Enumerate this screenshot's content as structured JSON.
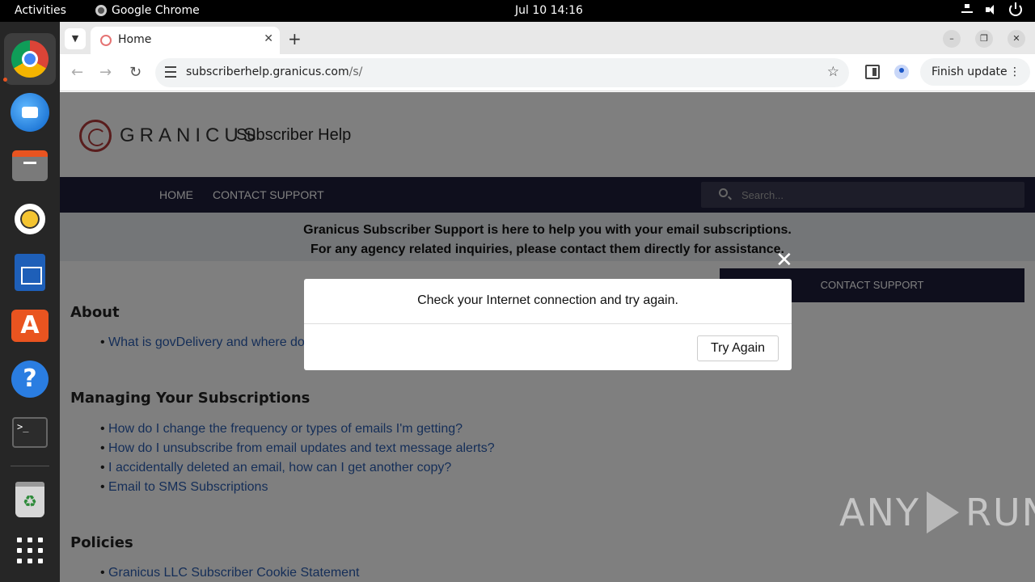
{
  "topbar": {
    "activities": "Activities",
    "app": "Google Chrome",
    "date": "Jul 10",
    "time": "14:16"
  },
  "dock": {
    "icons": [
      "chrome-icon",
      "thunderbird-icon",
      "files-icon",
      "rhythmbox-icon",
      "writer-icon",
      "app-center-icon",
      "help-icon",
      "terminal-icon",
      "trash-icon",
      "app-grid-icon"
    ]
  },
  "browser": {
    "tab_title": "Home",
    "url_host": "subscriberhelp.granicus.com",
    "url_path": "/s/",
    "finish_update": "Finish update"
  },
  "site": {
    "logo_text": "GRANICUS",
    "logo_sub": "Subscriber Help",
    "nav": [
      "HOME",
      "CONTACT SUPPORT"
    ],
    "search_placeholder": "Search...",
    "banner_line1": "Granicus Subscriber Support is here to help you with your email subscriptions.",
    "banner_line2": "For any agency related inquiries, please contact them directly for assistance.",
    "contact_button": "CONTACT SUPPORT",
    "sections": [
      {
        "title": "About",
        "links": [
          "What is govDelivery and where do"
        ]
      },
      {
        "title": "Managing Your Subscriptions",
        "links": [
          "How do I change the frequency or types of emails I'm getting?",
          "How do I unsubscribe from email updates and text message alerts?",
          "I accidentally deleted an email, how can I get another copy?",
          "Email to SMS Subscriptions"
        ]
      },
      {
        "title": "Policies",
        "links": [
          "Granicus LLC Subscriber Cookie Statement"
        ]
      }
    ]
  },
  "modal": {
    "message": "Check your Internet connection and try again.",
    "button": "Try Again",
    "close": "✕"
  },
  "watermark": {
    "left": "ANY",
    "right": "RUN"
  }
}
